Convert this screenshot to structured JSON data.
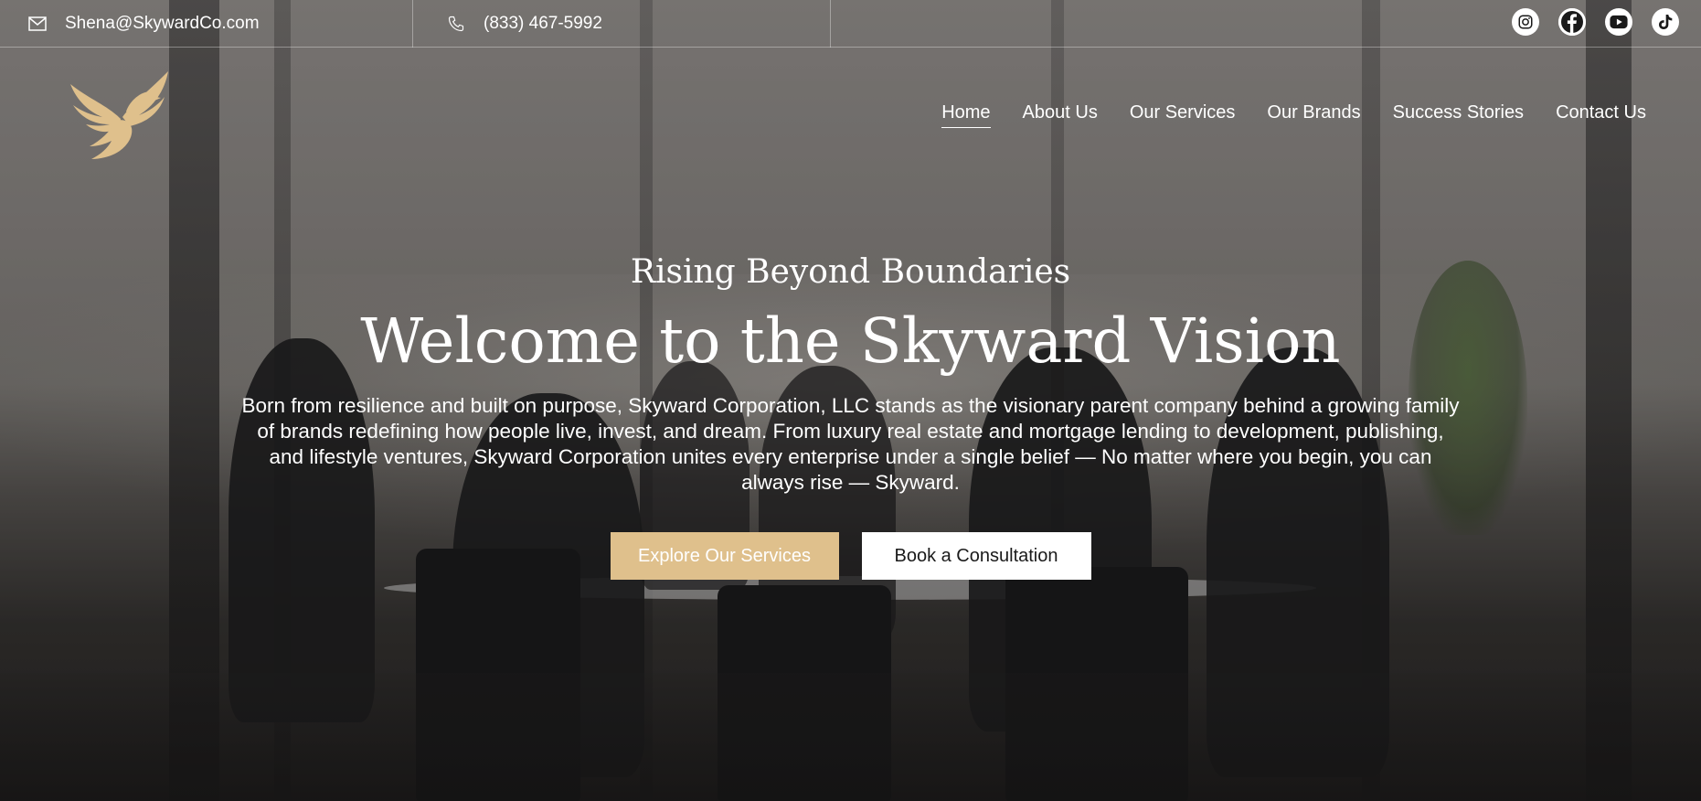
{
  "topbar": {
    "email": "Shena@SkywardCo.com",
    "phone": "(833) 467-5992",
    "socials": [
      {
        "name": "instagram-icon"
      },
      {
        "name": "facebook-icon"
      },
      {
        "name": "youtube-icon"
      },
      {
        "name": "tiktok-icon"
      }
    ]
  },
  "brand": {
    "logo_icon": "phoenix-bird-logo",
    "accent_color": "#dfc08c"
  },
  "nav": {
    "items": [
      {
        "label": "Home",
        "active": true
      },
      {
        "label": "About Us",
        "active": false
      },
      {
        "label": "Our Services",
        "active": false
      },
      {
        "label": "Our Brands",
        "active": false
      },
      {
        "label": "Success Stories",
        "active": false
      },
      {
        "label": "Contact Us",
        "active": false
      }
    ]
  },
  "hero": {
    "tagline": "Rising Beyond Boundaries",
    "headline": "Welcome to the Skyward Vision",
    "intro": "Born from resilience and built on purpose, Skyward Corporation, LLC stands as the visionary parent company behind a growing family of brands redefining how people live, invest, and dream. From luxury real estate and mortgage lending to development, publishing, and lifestyle ventures, Skyward Corporation unites every enterprise under a single belief — No matter where you begin, you can always rise — Skyward.",
    "primary_cta": "Explore Our Services",
    "secondary_cta": "Book a Consultation"
  }
}
